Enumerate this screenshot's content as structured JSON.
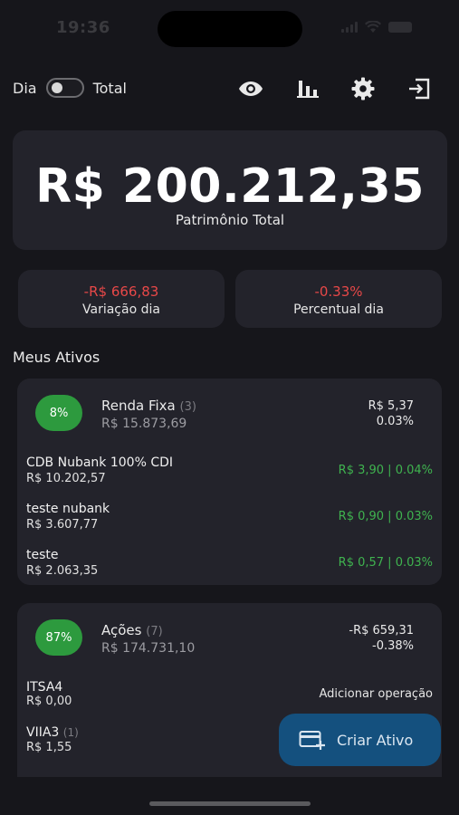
{
  "status_bar": {
    "time": "19:36"
  },
  "toolbar": {
    "toggle_left": "Dia",
    "toggle_right": "Total",
    "icons": [
      "eye-icon",
      "bar-chart-icon",
      "gear-icon",
      "logout-icon"
    ]
  },
  "summary": {
    "total_value": "R$ 200.212,35",
    "total_label": "Patrimônio Total",
    "variation_value": "-R$ 666,83",
    "variation_label": "Variação dia",
    "percent_value": "-0.33%",
    "percent_label": "Percentual dia"
  },
  "section_title": "Meus Ativos",
  "groups": [
    {
      "percent": "8%",
      "name": "Renda Fixa",
      "count": "(3)",
      "total": "R$ 15.873,69",
      "change_value": "R$ 5,37",
      "change_pct": "0.03%",
      "assets": [
        {
          "name": "CDB Nubank 100% CDI",
          "value": "R$ 10.202,57",
          "change": "R$ 3,90 | 0.04%"
        },
        {
          "name": "teste nubank",
          "value": "R$ 3.607,77",
          "change": "R$ 0,90 | 0.03%"
        },
        {
          "name": "teste",
          "value": "R$ 2.063,35",
          "change": "R$ 0,57 | 0.03%"
        }
      ]
    },
    {
      "percent": "87%",
      "name": "Ações",
      "count": "(7)",
      "total": "R$ 174.731,10",
      "change_value": "-R$ 659,31",
      "change_pct": "-0.38%",
      "assets": [
        {
          "name": "ITSA4",
          "count": "",
          "value": "R$ 0,00",
          "change": "Adicionar operação"
        },
        {
          "name": "VIIA3",
          "count": "(1)",
          "value": "R$ 1,55",
          "change": ""
        }
      ]
    }
  ],
  "fab": {
    "label": "Criar Ativo"
  },
  "colors": {
    "background": "#16161b",
    "card": "#23232b",
    "negative": "#e84848",
    "positive": "#3fb34f",
    "percent_badge": "#2d9a3e",
    "fab": "#14507e"
  }
}
